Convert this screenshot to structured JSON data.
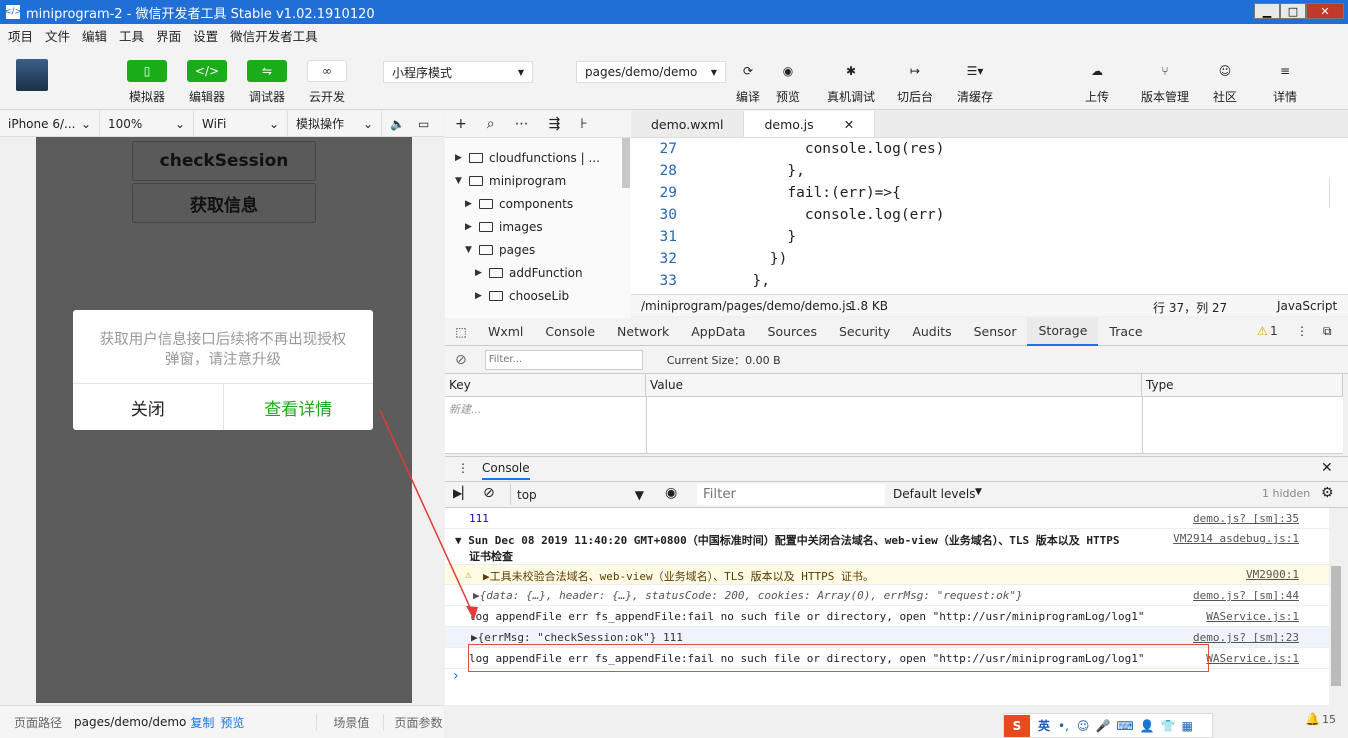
{
  "window": {
    "title": "miniprogram-2 - 微信开发者工具 Stable v1.02.1910120",
    "min": "▁",
    "max": "□",
    "close": "✕"
  },
  "menu": [
    "项目",
    "文件",
    "编辑",
    "工具",
    "界面",
    "设置",
    "微信开发者工具"
  ],
  "toolbar": {
    "simulator": "模拟器",
    "editor": "编辑器",
    "debugger": "调试器",
    "cloud": "云开发",
    "mode_select": "小程序模式",
    "page_select": "pages/demo/demo",
    "compile": "编译",
    "preview": "预览",
    "remote_debug": "真机调试",
    "background": "切后台",
    "clear_cache": "清缓存",
    "upload": "上传",
    "version": "版本管理",
    "community": "社区",
    "details": "详情"
  },
  "simbar": {
    "device": "iPhone 6/...",
    "zoom": "100%",
    "network": "WiFi",
    "operation": "模拟操作"
  },
  "phone": {
    "btn1": "checkSession",
    "btn2": "获取信息",
    "modal_text": "获取用户信息接口后续将不再出现授权弹窗，请注意升级",
    "modal_close": "关闭",
    "modal_detail": "查看详情"
  },
  "status": {
    "path_label": "页面路径",
    "path": "pages/demo/demo",
    "copy": "复制",
    "preview": "预览",
    "scene": "场景值",
    "params": "页面参数"
  },
  "tree": [
    {
      "label": "cloudfunctions | ...",
      "depth": 0,
      "open": false
    },
    {
      "label": "miniprogram",
      "depth": 0,
      "open": true
    },
    {
      "label": "components",
      "depth": 1,
      "open": false
    },
    {
      "label": "images",
      "depth": 1,
      "open": false
    },
    {
      "label": "pages",
      "depth": 1,
      "open": true
    },
    {
      "label": "addFunction",
      "depth": 2,
      "open": false
    },
    {
      "label": "chooseLib",
      "depth": 2,
      "open": false
    }
  ],
  "tabs": {
    "tab1": "demo.wxml",
    "tab2": "demo.js"
  },
  "code": {
    "lines": [
      "27",
      "28",
      "29",
      "30",
      "31",
      "32",
      "33"
    ],
    "text": [
      "        console.log(res)",
      "      },",
      "      fail:(err)=>{",
      "        console.log(err)",
      "      }",
      "    })",
      "  },"
    ]
  },
  "editor_status": {
    "path": "/miniprogram/pages/demo/demo.js",
    "size": "1.8 KB",
    "pos": "行 37，列 27",
    "lang": "JavaScript"
  },
  "devtabs": [
    "Wxml",
    "Console",
    "Network",
    "AppData",
    "Sources",
    "Security",
    "Audits",
    "Sensor",
    "Storage",
    "Trace"
  ],
  "devwarn": "1",
  "storage": {
    "filter_placeholder": "Filter...",
    "current_size": "Current Size：0.00 B",
    "col_key": "Key",
    "col_value": "Value",
    "col_type": "Type",
    "new": "新建..."
  },
  "console": {
    "title": "Console",
    "context": "top",
    "filter_placeholder": "Filter",
    "levels": "Default levels",
    "hidden": "1 hidden",
    "rows": [
      {
        "text": "111",
        "src": "demo.js? [sm]:35"
      },
      {
        "text": "▼ Sun Dec 08 2019 11:40:20 GMT+0800（中国标准时间）配置中关闭合法域名、web-view（业务域名）、TLS 版本以及 HTTPS",
        "text2": "证书检查",
        "src": "VM2914 asdebug.js:1"
      },
      {
        "text": "▶工具未校验合法域名、web-view（业务域名）、TLS 版本以及 HTTPS 证书。",
        "src": "VM2900:1"
      },
      {
        "text": "▶{data: {…}, header: {…}, statusCode: 200, cookies: Array(0), errMsg: \"request:ok\"}",
        "src": "demo.js? [sm]:44"
      },
      {
        "text": "log appendFile err fs_appendFile:fail no such file or directory, open \"http://usr/miniprogramLog/log1\"",
        "src": "WAService.js:1"
      },
      {
        "text": "▶{errMsg: \"checkSession:ok\"} 111",
        "src": "demo.js? [sm]:23"
      },
      {
        "text": "log appendFile err fs_appendFile:fail no such file or directory, open \"http://usr/miniprogramLog/log1\"",
        "src": "WAService.js:1"
      }
    ],
    "prompt": "›"
  },
  "ime": {
    "label": "英"
  },
  "notif": "15"
}
